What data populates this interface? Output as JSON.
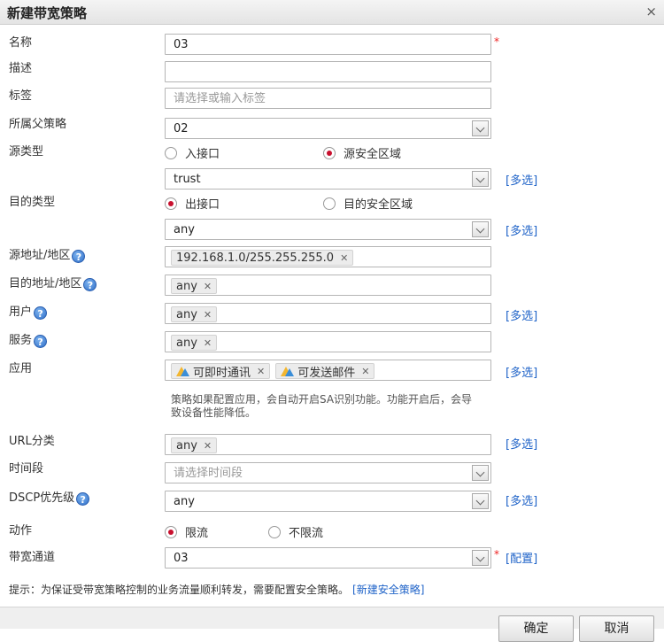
{
  "dialog": {
    "title": "新建带宽策略",
    "close": "×"
  },
  "form": {
    "name": {
      "label": "名称",
      "value": "03"
    },
    "desc": {
      "label": "描述",
      "value": ""
    },
    "tag": {
      "label": "标签",
      "placeholder": "请选择或输入标签"
    },
    "parent": {
      "label": "所属父策略",
      "value": "02"
    },
    "src_type": {
      "label": "源类型",
      "options": [
        "入接口",
        "源安全区域"
      ],
      "selected": "源安全区域",
      "zone_value": "trust"
    },
    "dst_type": {
      "label": "目的类型",
      "options": [
        "出接口",
        "目的安全区域"
      ],
      "selected": "出接口",
      "interface_value": "any"
    },
    "src_addr": {
      "label": "源地址/地区",
      "tags": [
        "192.168.1.0/255.255.255.0"
      ]
    },
    "dst_addr": {
      "label": "目的地址/地区",
      "tags": [
        "any"
      ]
    },
    "user": {
      "label": "用户",
      "tags": [
        "any"
      ]
    },
    "service": {
      "label": "服务",
      "tags": [
        "any"
      ]
    },
    "app": {
      "label": "应用",
      "tags": [
        "可即时通讯",
        "可发送邮件"
      ],
      "note": "策略如果配置应用，会自动开启SA识别功能。功能开启后，会导致设备性能降低。"
    },
    "url": {
      "label": "URL分类",
      "tags": [
        "any"
      ]
    },
    "time": {
      "label": "时间段",
      "placeholder": "请选择时间段"
    },
    "dscp": {
      "label": "DSCP优先级",
      "value": "any"
    },
    "action": {
      "label": "动作",
      "options": [
        "限流",
        "不限流"
      ],
      "selected": "限流"
    },
    "channel": {
      "label": "带宽通道",
      "value": "03",
      "config_link": "[配置]"
    },
    "multi_link": "[多选]",
    "required_mark": "*",
    "help_glyph": "?"
  },
  "hint": {
    "text": "提示：为保证受带宽策略控制的业务流量顺利转发，需要配置安全策略。",
    "link": "[新建安全策略]"
  },
  "buttons": {
    "ok": "确定",
    "cancel": "取消"
  }
}
